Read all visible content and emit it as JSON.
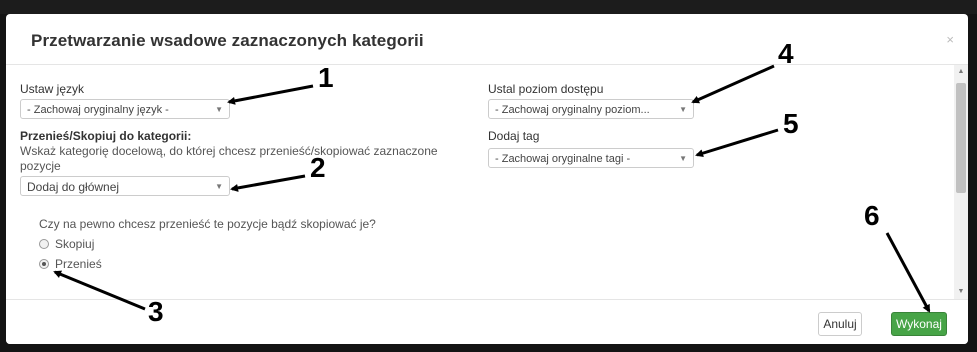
{
  "modal": {
    "title": "Przetwarzanie wsadowe zaznaczonych kategorii",
    "close_glyph": "×"
  },
  "left": {
    "language_label": "Ustaw język",
    "language_select": "- Zachowaj oryginalny język -",
    "move_label": "Przenieś/Skopiuj do kategorii:",
    "move_help": "Wskaż kategorię docelową, do której chcesz przenieść/skopiować zaznaczone pozycje",
    "category_select": "Dodaj do głównej",
    "question": "Czy na pewno chcesz przenieść te pozycje bądź skopiować je?",
    "radio_options": [
      {
        "label": "Skopiuj",
        "checked": false
      },
      {
        "label": "Przenieś",
        "checked": true
      }
    ]
  },
  "right": {
    "access_label": "Ustal poziom dostępu",
    "access_select": "- Zachowaj oryginalny poziom...",
    "tag_label": "Dodaj tag",
    "tag_select": "- Zachowaj oryginalne tagi -"
  },
  "footer": {
    "cancel_label": "Anuluj",
    "run_label": "Wykonaj"
  },
  "annotations": [
    "1",
    "2",
    "3",
    "4",
    "5",
    "6"
  ],
  "colors": {
    "primary_button": "#47a447",
    "backdrop": "#141414"
  }
}
